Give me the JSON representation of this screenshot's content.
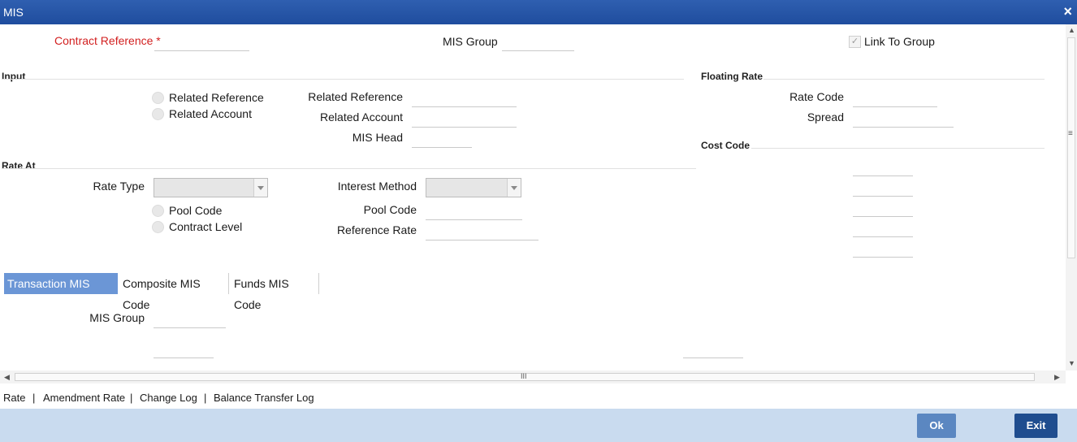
{
  "window": {
    "title": "MIS",
    "close_glyph": "×"
  },
  "header": {
    "contract_reference_label": "Contract Reference",
    "required_marker": "*",
    "mis_group_label": "MIS Group",
    "link_to_group_label": "Link To Group",
    "link_to_group_checked": true
  },
  "input_section": {
    "title": "Input",
    "radio_related_reference": "Related Reference",
    "radio_related_account": "Related Account",
    "related_reference_label": "Related Reference",
    "related_account_label": "Related Account",
    "mis_head_label": "MIS Head"
  },
  "floating_rate": {
    "title": "Floating Rate",
    "rate_code_label": "Rate Code",
    "spread_label": "Spread"
  },
  "cost_code": {
    "title": "Cost Code"
  },
  "rate_at": {
    "title": "Rate At",
    "rate_type_label": "Rate Type",
    "interest_method_label": "Interest Method",
    "radio_pool_code": "Pool Code",
    "radio_contract_level": "Contract Level",
    "pool_code_label": "Pool Code",
    "reference_rate_label": "Reference Rate"
  },
  "tabs": [
    {
      "label": "Transaction MIS Code",
      "active": true
    },
    {
      "label": "Composite MIS Code",
      "active": false
    },
    {
      "label": "Funds MIS Code",
      "active": false
    }
  ],
  "tab_content": {
    "mis_group_label": "MIS Group"
  },
  "footer_links": [
    "Rate",
    "|",
    "Amendment Rate",
    "|",
    "Change Log",
    "|",
    "Balance Transfer Log"
  ],
  "buttons": {
    "ok": "Ok",
    "exit": "Exit"
  },
  "scroll_glyphs": {
    "h_grip": "III",
    "v_grip": "≡"
  },
  "colors": {
    "title_bar": "#1f4d9e",
    "active_tab": "#6b96d6",
    "required": "#d21f1f",
    "footer_bar": "#c9dbef",
    "exit_button": "#1f4d8f",
    "ok_button": "#5b87c1"
  }
}
